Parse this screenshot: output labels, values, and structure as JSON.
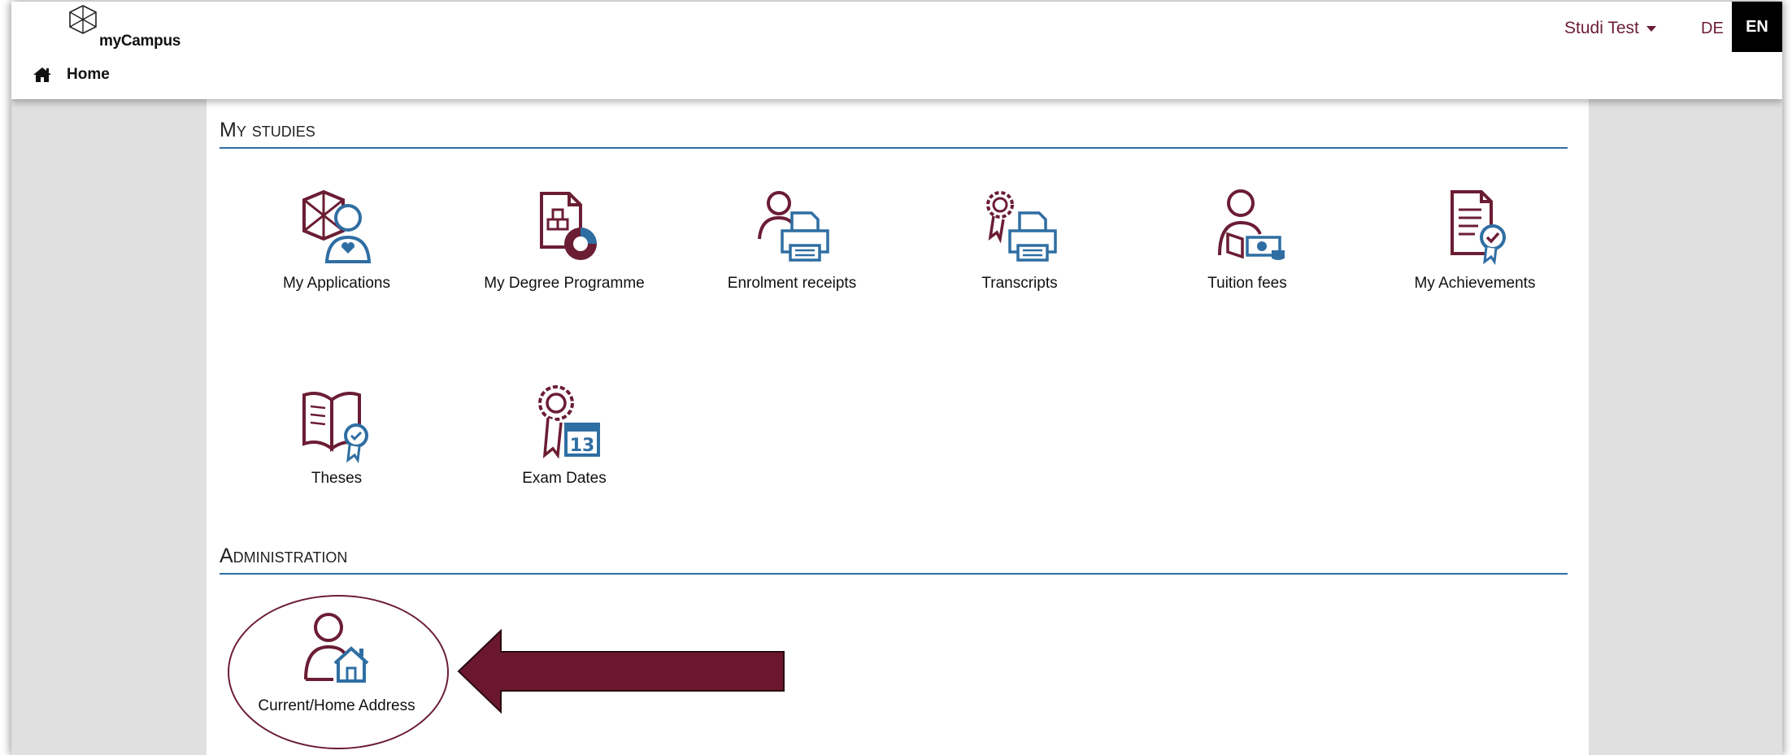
{
  "brand": {
    "name": "myCampus"
  },
  "breadcrumb": {
    "icon": "home-icon",
    "label": "Home"
  },
  "user": {
    "name": "Studi Test",
    "caret": "caret-down-icon"
  },
  "languages": {
    "de": "DE",
    "en": "EN",
    "active": "EN"
  },
  "colors": {
    "accent": "#6b1d34",
    "icon_blue": "#2f6ea3",
    "rule": "#2f6ea3"
  },
  "sections": {
    "my_studies": {
      "title": "My studies",
      "tiles": [
        {
          "label": "My Applications",
          "icon": "applications-icon"
        },
        {
          "label": "My Degree Programme",
          "icon": "degree-programme-icon"
        },
        {
          "label": "Enrolment receipts",
          "icon": "enrolment-printer-icon"
        },
        {
          "label": "Transcripts",
          "icon": "transcripts-printer-icon"
        },
        {
          "label": "Tuition fees",
          "icon": "tuition-fees-icon"
        },
        {
          "label": "My Achievements",
          "icon": "achievements-icon"
        },
        {
          "label": "Theses",
          "icon": "theses-book-icon"
        },
        {
          "label": "Exam Dates",
          "icon": "exam-calendar-icon",
          "calendar_day": "13"
        }
      ]
    },
    "administration": {
      "title": "Administration",
      "tiles": [
        {
          "label": "Current/Home Address",
          "icon": "home-address-icon"
        }
      ]
    }
  }
}
